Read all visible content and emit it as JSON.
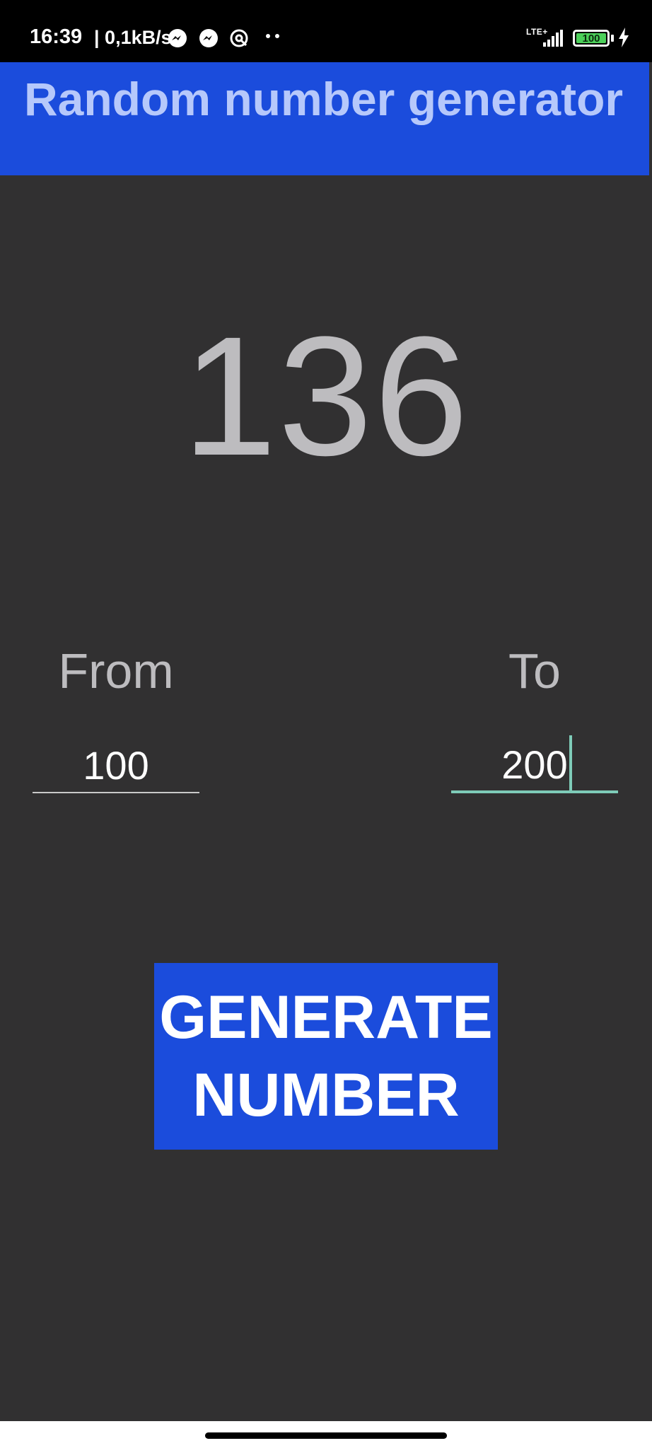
{
  "status_bar": {
    "time": "16:39",
    "speed": "| 0,1kB/s",
    "network": "LTE+",
    "battery": "100",
    "icons": [
      "messenger-icon",
      "messenger-icon",
      "vpn-icon",
      "more-dots-icon",
      "signal-icon",
      "battery-icon",
      "charging-bolt-icon"
    ]
  },
  "header": {
    "title": "Random number generator"
  },
  "result": {
    "value": "136"
  },
  "range": {
    "from_label": "From",
    "from_value": "100",
    "to_label": "To",
    "to_value": "200"
  },
  "generate_button": {
    "line1": "GENERATE",
    "line2": "NUMBER"
  },
  "colors": {
    "background": "#313031",
    "accent": "#1b4cdc",
    "title_text": "#b6c8fb",
    "result_text": "#bdbcbf",
    "focus_underline": "#7ecbb8"
  }
}
